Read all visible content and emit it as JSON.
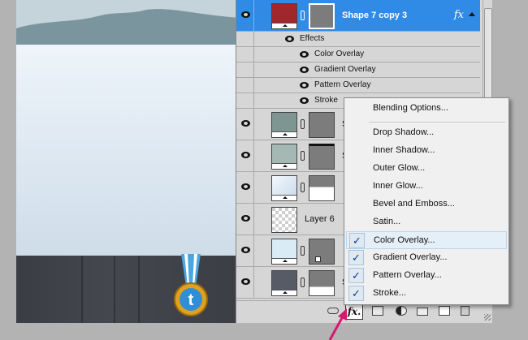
{
  "layers_panel": {
    "selected_layer": {
      "name": "Shape 7 copy 3",
      "fx_badge": "fx",
      "color_swatch": "#a0272b"
    },
    "effects_header": "Effects",
    "effects": [
      "Color Overlay",
      "Gradient Overlay",
      "Pattern Overlay",
      "Stroke"
    ],
    "rows": [
      {
        "name": "S",
        "thumb_color": "#7d9691",
        "has_mask": true,
        "mask_style": "gray"
      },
      {
        "name": "S",
        "thumb_color": "#a6b8b3",
        "has_mask": true,
        "mask_style": "gray-bar"
      },
      {
        "name": "",
        "thumb_color": "#dce7f3",
        "has_mask": true,
        "mask_style": "white-bottom"
      },
      {
        "name": "Layer 6",
        "thumb_color": "transparent",
        "has_mask": false,
        "mask_style": "none"
      },
      {
        "name": "",
        "thumb_color": "#d9ebf5",
        "has_mask": true,
        "mask_style": "gray-dot"
      },
      {
        "name": "S",
        "thumb_color": "#565b66",
        "has_mask": true,
        "mask_style": "white-bottom"
      }
    ]
  },
  "fx_menu": {
    "items": [
      {
        "label": "Blending Options...",
        "checked": false
      },
      {
        "label": "Drop Shadow...",
        "checked": false
      },
      {
        "label": "Inner Shadow...",
        "checked": false
      },
      {
        "label": "Outer Glow...",
        "checked": false
      },
      {
        "label": "Inner Glow...",
        "checked": false
      },
      {
        "label": "Bevel and Emboss...",
        "checked": false
      },
      {
        "label": "Satin...",
        "checked": false
      },
      {
        "label": "Color Overlay...",
        "checked": true,
        "hovered": true
      },
      {
        "label": "Gradient Overlay...",
        "checked": true
      },
      {
        "label": "Pattern Overlay...",
        "checked": true
      },
      {
        "label": "Stroke...",
        "checked": true
      }
    ],
    "check_glyph": "✓"
  },
  "footer": {
    "fx_button": "fx."
  },
  "icons": {
    "medal": "twitter-medal-icon",
    "pointer": "magenta-arrow-pointer"
  },
  "colors": {
    "selection": "#2f8be6",
    "menu_hover": "#e4eff8",
    "pointer": "#d6196f"
  }
}
